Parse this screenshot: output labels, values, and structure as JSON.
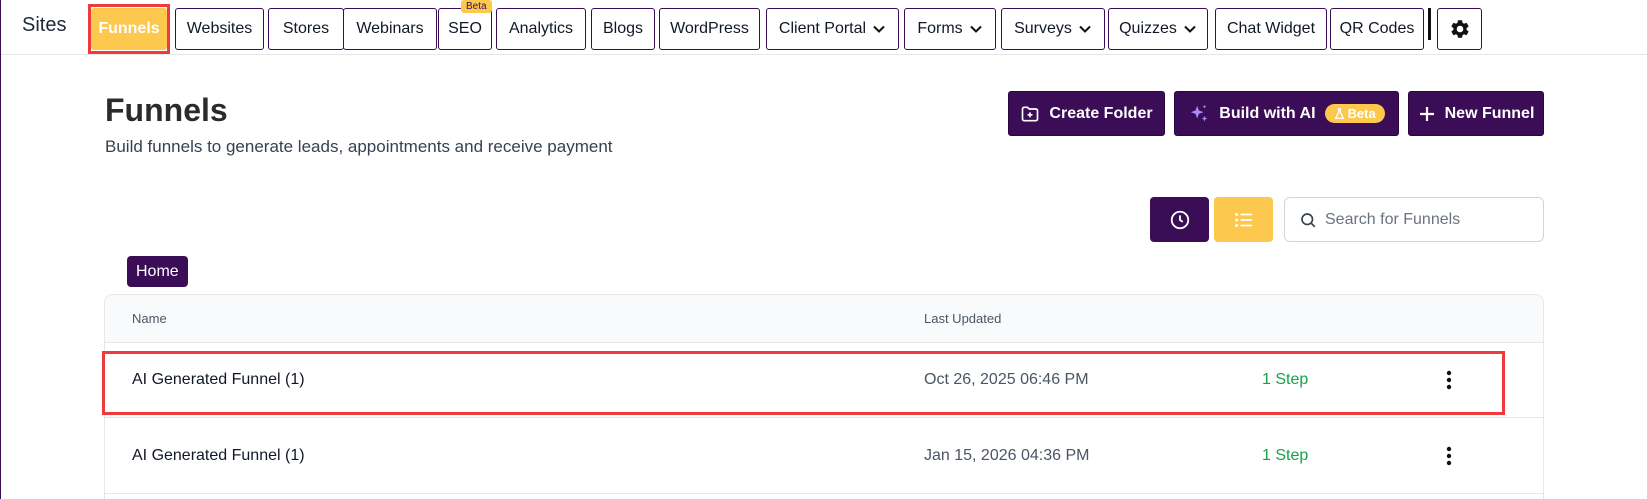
{
  "brand": "Sites",
  "nav": {
    "items": [
      {
        "label": "Funnels"
      },
      {
        "label": "Websites"
      },
      {
        "label": "Stores"
      },
      {
        "label": "Webinars"
      },
      {
        "label": "SEO"
      },
      {
        "label": "Analytics"
      },
      {
        "label": "Blogs"
      },
      {
        "label": "WordPress"
      },
      {
        "label": "Client Portal"
      },
      {
        "label": "Forms"
      },
      {
        "label": "Surveys"
      },
      {
        "label": "Quizzes"
      },
      {
        "label": "Chat Widget"
      },
      {
        "label": "QR Codes"
      }
    ],
    "seo_badge": "Beta",
    "settings_icon": "gear-icon"
  },
  "header": {
    "title": "Funnels",
    "subtitle": "Build funnels to generate leads, appointments and receive payment",
    "create_folder_label": "Create Folder",
    "build_ai_label": "Build with AI",
    "build_ai_badge": "Beta",
    "new_funnel_label": "New Funnel"
  },
  "toolbar": {
    "search_placeholder": "Search for Funnels"
  },
  "breadcrumb": {
    "home": "Home"
  },
  "table": {
    "columns": {
      "name": "Name",
      "last_updated": "Last Updated"
    },
    "rows": [
      {
        "name": "AI Generated Funnel (1)",
        "last_updated": "Oct 26, 2025 06:46 PM",
        "steps": "1 Step"
      },
      {
        "name": "AI Generated Funnel (1)",
        "last_updated": "Jan 15, 2026 04:36 PM",
        "steps": "1 Step"
      }
    ]
  },
  "colors": {
    "primary": "#3b0d56",
    "accent": "#fcc84d",
    "success": "#16a34a",
    "highlight": "#ef3b3b"
  }
}
